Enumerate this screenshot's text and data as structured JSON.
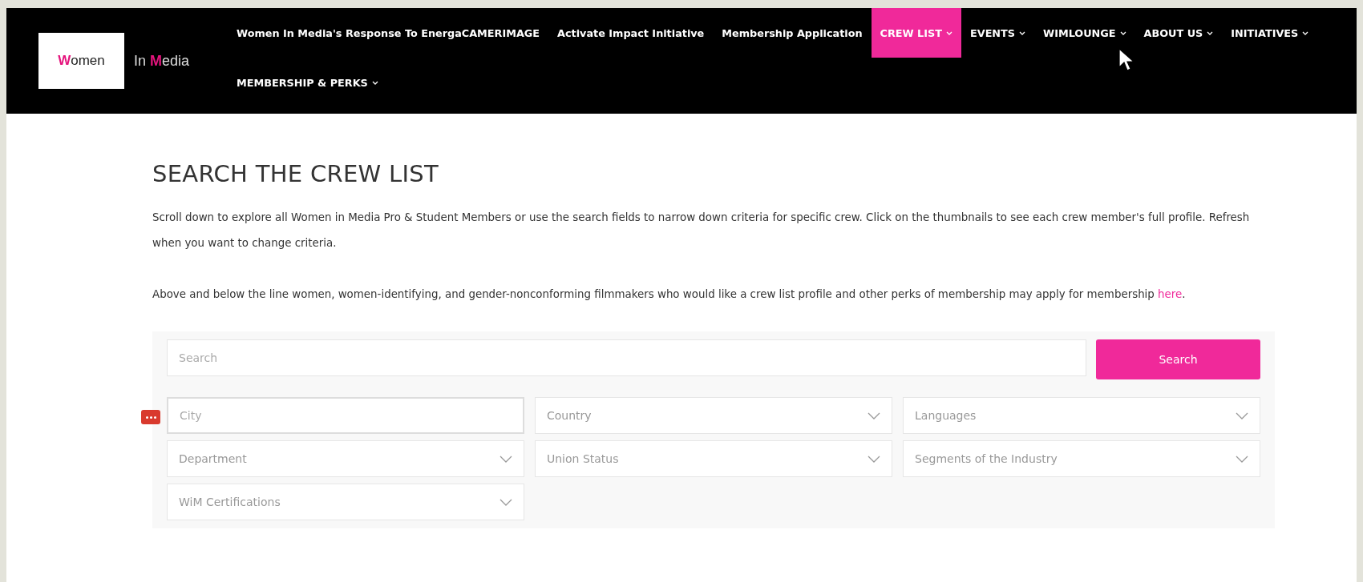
{
  "logo": {
    "box_accent": "W",
    "box_rest": "omen",
    "side_start": "In ",
    "side_accent": "M",
    "side_end": "edia"
  },
  "nav": [
    {
      "label": "Women In Media's Response To EnergaCAMERIMAGE",
      "dropdown": false,
      "selected": false
    },
    {
      "label": "Activate Impact Initiative",
      "dropdown": false,
      "selected": false
    },
    {
      "label": "Membership Application",
      "dropdown": false,
      "selected": false
    },
    {
      "label": "CREW LIST",
      "dropdown": true,
      "selected": true
    },
    {
      "label": "EVENTS",
      "dropdown": true,
      "selected": false
    },
    {
      "label": "WIMLOUNGE",
      "dropdown": true,
      "selected": false
    },
    {
      "label": "ABOUT US",
      "dropdown": true,
      "selected": false
    },
    {
      "label": "INITIATIVES",
      "dropdown": true,
      "selected": false
    },
    {
      "label": "MEMBERSHIP & PERKS",
      "dropdown": true,
      "selected": false
    }
  ],
  "heading": "SEARCH THE CREW LIST",
  "paragraphs": [
    {
      "text": "Scroll down to explore all Women in Media Pro & Student Members or use the search fields to narrow down criteria for specific crew. Click on the thumbnails to see each crew member's full profile. Refresh when you want to change criteria."
    },
    {
      "text": "Above and below the line women, women-identifying, and gender-nonconforming filmmakers who would like a crew list profile and other perks of membership may apply for membership ",
      "link": "here",
      "after": "."
    }
  ],
  "search": {
    "placeholder": "Search",
    "button": "Search"
  },
  "filters": [
    {
      "kind": "text",
      "placeholder": "City"
    },
    {
      "kind": "select",
      "placeholder": "Country"
    },
    {
      "kind": "select",
      "placeholder": "Languages"
    },
    {
      "kind": "select",
      "placeholder": "Department"
    },
    {
      "kind": "select",
      "placeholder": "Union Status"
    },
    {
      "kind": "select",
      "placeholder": "Segments of the Industry"
    },
    {
      "kind": "select",
      "placeholder": "WiM Certifications"
    }
  ]
}
